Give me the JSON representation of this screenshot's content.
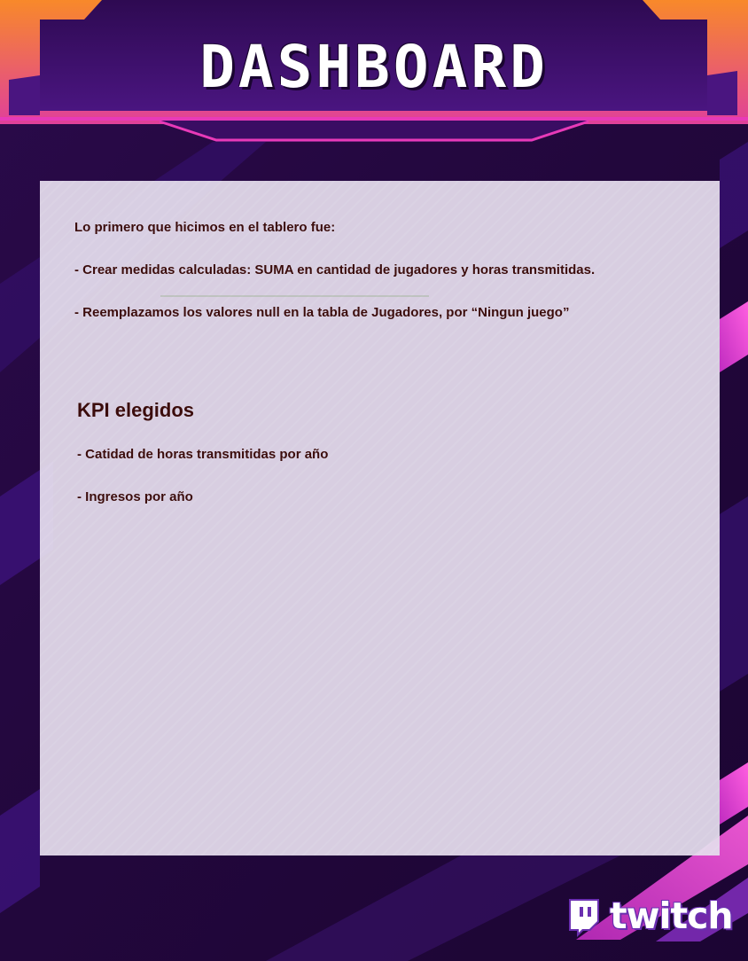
{
  "header": {
    "title": "DASHBOARD"
  },
  "notes": {
    "intro": "Lo primero que hicimos en el tablero fue:",
    "items": [
      "- Crear medidas calculadas: SUMA en cantidad de jugadores y horas transmitidas.",
      "- Reemplazamos los valores null en la tabla de Jugadores, por “Ningun juego”"
    ]
  },
  "kpi": {
    "title": "KPI elegidos",
    "items": [
      "- Catidad de horas transmitidas por año",
      "- Ingresos por año"
    ]
  },
  "logo": {
    "wordmark": "twitch",
    "icon": "twitch-glitch-icon"
  },
  "colors": {
    "background": "#24093f",
    "accent_pink": "#e040c8",
    "accent_orange": "#f07a28",
    "header_purple": "#3a0d63",
    "text": "#3b0c0c"
  }
}
